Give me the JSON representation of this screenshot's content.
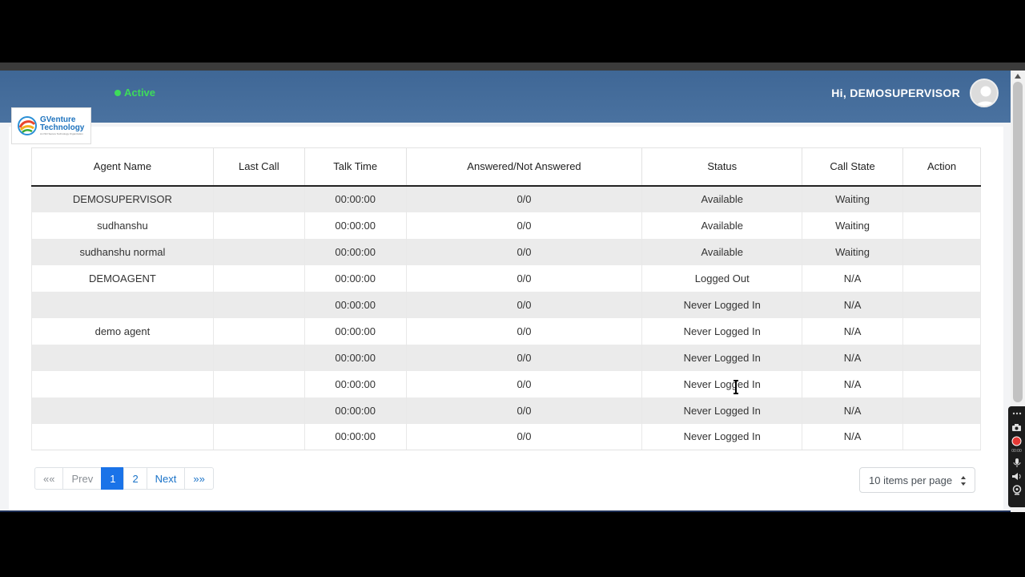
{
  "header": {
    "status_label": "Active",
    "greeting": "Hi, DEMOSUPERVISOR"
  },
  "logo": {
    "name_line1": "GVenture",
    "name_line2": "Technology",
    "tagline": "An ISO Secure Technology Organization"
  },
  "table": {
    "columns": [
      "Agent Name",
      "Last Call",
      "Talk Time",
      "Answered/Not Answered",
      "Status",
      "Call State",
      "Action"
    ],
    "rows": [
      [
        "DEMOSUPERVISOR",
        "",
        "00:00:00",
        "0/0",
        "Available",
        "Waiting",
        ""
      ],
      [
        "sudhanshu",
        "",
        "00:00:00",
        "0/0",
        "Available",
        "Waiting",
        ""
      ],
      [
        "sudhanshu normal",
        "",
        "00:00:00",
        "0/0",
        "Available",
        "Waiting",
        ""
      ],
      [
        "DEMOAGENT",
        "",
        "00:00:00",
        "0/0",
        "Logged Out",
        "N/A",
        ""
      ],
      [
        "",
        "",
        "00:00:00",
        "0/0",
        "Never Logged In",
        "N/A",
        ""
      ],
      [
        "demo agent",
        "",
        "00:00:00",
        "0/0",
        "Never Logged In",
        "N/A",
        ""
      ],
      [
        "",
        "",
        "00:00:00",
        "0/0",
        "Never Logged In",
        "N/A",
        ""
      ],
      [
        "",
        "",
        "00:00:00",
        "0/0",
        "Never Logged In",
        "N/A",
        ""
      ],
      [
        "",
        "",
        "00:00:00",
        "0/0",
        "Never Logged In",
        "N/A",
        ""
      ],
      [
        "",
        "",
        "00:00:00",
        "0/0",
        "Never Logged In",
        "N/A",
        ""
      ]
    ]
  },
  "pagination": {
    "first": "««",
    "prev": "Prev",
    "pages": [
      "1",
      "2"
    ],
    "current": "1",
    "next": "Next",
    "last": "»»"
  },
  "per_page": {
    "selected": "10 items per page"
  },
  "recorder": {
    "time": "00:00"
  },
  "colors": {
    "header_bg": "#45699a",
    "active_green": "#3ddc5a",
    "accent_blue": "#1a73e8"
  }
}
